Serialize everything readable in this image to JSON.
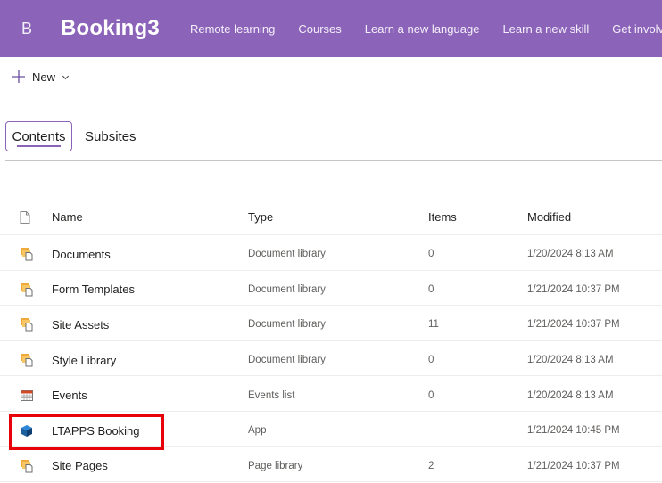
{
  "header": {
    "logo_letter": "B",
    "site_title": "Booking3",
    "nav": [
      "Remote learning",
      "Courses",
      "Learn a new language",
      "Learn a new skill",
      "Get involved"
    ]
  },
  "command_bar": {
    "new_label": "New"
  },
  "tabs": [
    {
      "label": "Contents",
      "active": true
    },
    {
      "label": "Subsites",
      "active": false
    }
  ],
  "table": {
    "columns": {
      "name": "Name",
      "type": "Type",
      "items": "Items",
      "modified": "Modified"
    },
    "rows": [
      {
        "icon": "document-library-icon",
        "name": "Documents",
        "type": "Document library",
        "items": "0",
        "modified": "1/20/2024 8:13 AM"
      },
      {
        "icon": "document-library-icon",
        "name": "Form Templates",
        "type": "Document library",
        "items": "0",
        "modified": "1/21/2024 10:37 PM"
      },
      {
        "icon": "document-library-icon",
        "name": "Site Assets",
        "type": "Document library",
        "items": "11",
        "modified": "1/21/2024 10:37 PM"
      },
      {
        "icon": "document-library-icon",
        "name": "Style Library",
        "type": "Document library",
        "items": "0",
        "modified": "1/20/2024 8:13 AM"
      },
      {
        "icon": "events-calendar-icon",
        "name": "Events",
        "type": "Events list",
        "items": "0",
        "modified": "1/20/2024 8:13 AM"
      },
      {
        "icon": "app-icon",
        "name": "LTAPPS Booking",
        "type": "App",
        "items": "",
        "modified": "1/21/2024 10:45 PM",
        "highlighted": true
      },
      {
        "icon": "document-library-icon",
        "name": "Site Pages",
        "type": "Page library",
        "items": "2",
        "modified": "1/21/2024 10:37 PM"
      }
    ]
  },
  "colors": {
    "header_bg": "#8b63b8",
    "accent": "#8b63b8",
    "highlight": "#e8000b",
    "library_icon": "#f0a93b"
  }
}
